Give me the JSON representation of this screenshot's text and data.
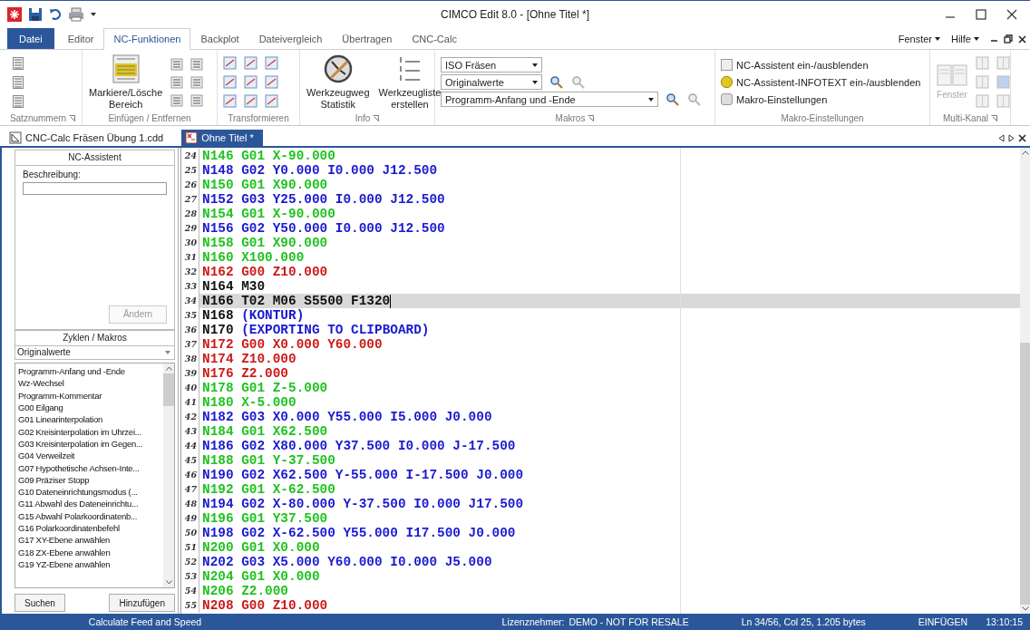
{
  "window": {
    "title": "CIMCO Edit 8.0 - [Ohne Titel *]"
  },
  "ribbon_tabs": [
    {
      "label": "Datei",
      "kind": "file",
      "selected": false
    },
    {
      "label": "Editor",
      "kind": "tab",
      "selected": false
    },
    {
      "label": "NC-Funktionen",
      "kind": "tab",
      "selected": true
    },
    {
      "label": "Backplot",
      "kind": "tab",
      "selected": false
    },
    {
      "label": "Dateivergleich",
      "kind": "tab",
      "selected": false
    },
    {
      "label": "Übertragen",
      "kind": "tab",
      "selected": false
    },
    {
      "label": "CNC-Calc",
      "kind": "tab",
      "selected": false
    }
  ],
  "menu_right": [
    "Fenster",
    "Hilfe"
  ],
  "ribbon_groups": [
    {
      "kind": "numbers",
      "label": "Satznummern",
      "launcher": true
    },
    {
      "kind": "insert",
      "label": "Einfügen / Entfernen",
      "launcher": false,
      "buttons": [
        {
          "label": "Markiere/Lösche Bereich",
          "disabled": false
        }
      ]
    },
    {
      "kind": "transform",
      "label": "Transformieren",
      "launcher": false
    },
    {
      "kind": "info",
      "label": "Info",
      "launcher": true,
      "buttons": [
        {
          "label": "Werkzeugweg Statistik",
          "disabled": false
        },
        {
          "label": "Werkzeugliste erstellen",
          "disabled": false
        }
      ]
    },
    {
      "kind": "macros",
      "label": "Makros",
      "launcher": true,
      "dropdowns": [
        "ISO Fräsen",
        "Originalwerte",
        "Programm-Anfang und -Ende"
      ]
    },
    {
      "kind": "settings",
      "label": "Makro-Einstellungen",
      "launcher": false,
      "items": [
        "NC-Assistent ein-/ausblenden",
        "NC-Assistent-INFOTEXT ein-/ausblenden",
        "Makro-Einstellungen"
      ]
    },
    {
      "kind": "multi",
      "label": "Multi-Kanal",
      "launcher": true,
      "buttons": [
        {
          "label": "Fenster",
          "disabled": true
        }
      ]
    }
  ],
  "doc_tabs": [
    {
      "label": "CNC-Calc Fräsen Übung 1.cdd",
      "selected": false
    },
    {
      "label": "Ohne Titel *",
      "selected": true
    }
  ],
  "assistant": {
    "title": "NC-Assistent",
    "description_label": "Beschreibung:",
    "change_button": "Ändern",
    "change_disabled": true,
    "macros_title": "Zyklen / Makros",
    "filter": "Originalwerte",
    "items": [
      "Programm-Anfang und -Ende",
      "Wz-Wechsel",
      "Programm-Kommentar",
      "G00 Eilgang",
      "G01 Linearinterpolation",
      "G02 Kreisinterpolation im Uhrzei...",
      "G03 Kreisinterpolation im Gegen...",
      "G04 Verweilzeit",
      "G07 Hypothetische Achsen-Inte...",
      "G09 Präziser Stopp",
      "G10 Dateneinrichtungsmodus (...",
      "G11 Abwahl des Dateneinrichtu...",
      "G15 Abwahl Polarkoordinatenb...",
      "G16 Polarkoordinatenbefehl",
      "G17 XY-Ebene anwählen",
      "G18 ZX-Ebene anwählen",
      "G19 YZ-Ebene anwählen"
    ],
    "buttons": [
      "Suchen",
      "Hinzufügen"
    ]
  },
  "code_lines": [
    {
      "number": "24",
      "current": false,
      "segments": [
        {
          "text": "N146 G01 X-90.000",
          "color": "#1fc21f"
        }
      ]
    },
    {
      "number": "25",
      "current": false,
      "segments": [
        {
          "text": "N148 G02 Y0.000 I0.000 J12.500",
          "color": "#1a1ad0"
        }
      ]
    },
    {
      "number": "26",
      "current": false,
      "segments": [
        {
          "text": "N150 G01 X90.000",
          "color": "#1fc21f"
        }
      ]
    },
    {
      "number": "27",
      "current": false,
      "segments": [
        {
          "text": "N152 G03 Y25.000 I0.000 J12.500",
          "color": "#1a1ad0"
        }
      ]
    },
    {
      "number": "28",
      "current": false,
      "segments": [
        {
          "text": "N154 G01 X-90.000",
          "color": "#1fc21f"
        }
      ]
    },
    {
      "number": "29",
      "current": false,
      "segments": [
        {
          "text": "N156 G02 Y50.000 I0.000 J12.500",
          "color": "#1a1ad0"
        }
      ]
    },
    {
      "number": "30",
      "current": false,
      "segments": [
        {
          "text": "N158 G01 X90.000",
          "color": "#1fc21f"
        }
      ]
    },
    {
      "number": "31",
      "current": false,
      "segments": [
        {
          "text": "N160 X100.000",
          "color": "#1fc21f"
        }
      ]
    },
    {
      "number": "32",
      "current": false,
      "segments": [
        {
          "text": "N162 G00 Z10.000",
          "color": "#cc1a1a"
        }
      ]
    },
    {
      "number": "33",
      "current": false,
      "segments": [
        {
          "text": "N164 M30",
          "color": "#111111"
        }
      ]
    },
    {
      "number": "34",
      "current": true,
      "segments": [
        {
          "text": "N166 T02 M06 S5500 F1320",
          "color": "#111111"
        }
      ]
    },
    {
      "number": "35",
      "current": false,
      "segments": [
        {
          "text": "N168 ",
          "color": "#111111"
        },
        {
          "text": "(KONTUR)",
          "color": "#1a1ad0"
        }
      ]
    },
    {
      "number": "36",
      "current": false,
      "segments": [
        {
          "text": "N170 ",
          "color": "#111111"
        },
        {
          "text": "(EXPORTING TO CLIPBOARD)",
          "color": "#1a1ad0"
        }
      ]
    },
    {
      "number": "37",
      "current": false,
      "segments": [
        {
          "text": "N172 G00 X0.000 Y60.000",
          "color": "#cc1a1a"
        }
      ]
    },
    {
      "number": "38",
      "current": false,
      "segments": [
        {
          "text": "N174 Z10.000",
          "color": "#cc1a1a"
        }
      ]
    },
    {
      "number": "39",
      "current": false,
      "segments": [
        {
          "text": "N176 Z2.000",
          "color": "#cc1a1a"
        }
      ]
    },
    {
      "number": "40",
      "current": false,
      "segments": [
        {
          "text": "N178 G01 Z-5.000",
          "color": "#1fc21f"
        }
      ]
    },
    {
      "number": "41",
      "current": false,
      "segments": [
        {
          "text": "N180 X-5.000",
          "color": "#1fc21f"
        }
      ]
    },
    {
      "number": "42",
      "current": false,
      "segments": [
        {
          "text": "N182 G03 X0.000 Y55.000 I5.000 J0.000",
          "color": "#1a1ad0"
        }
      ]
    },
    {
      "number": "43",
      "current": false,
      "segments": [
        {
          "text": "N184 G01 X62.500",
          "color": "#1fc21f"
        }
      ]
    },
    {
      "number": "44",
      "current": false,
      "segments": [
        {
          "text": "N186 G02 X80.000 Y37.500 I0.000 J-17.500",
          "color": "#1a1ad0"
        }
      ]
    },
    {
      "number": "45",
      "current": false,
      "segments": [
        {
          "text": "N188 G01 Y-37.500",
          "color": "#1fc21f"
        }
      ]
    },
    {
      "number": "46",
      "current": false,
      "segments": [
        {
          "text": "N190 G02 X62.500 Y-55.000 I-17.500 J0.000",
          "color": "#1a1ad0"
        }
      ]
    },
    {
      "number": "47",
      "current": false,
      "segments": [
        {
          "text": "N192 G01 X-62.500",
          "color": "#1fc21f"
        }
      ]
    },
    {
      "number": "48",
      "current": false,
      "segments": [
        {
          "text": "N194 G02 X-80.000 Y-37.500 I0.000 J17.500",
          "color": "#1a1ad0"
        }
      ]
    },
    {
      "number": "49",
      "current": false,
      "segments": [
        {
          "text": "N196 G01 Y37.500",
          "color": "#1fc21f"
        }
      ]
    },
    {
      "number": "50",
      "current": false,
      "segments": [
        {
          "text": "N198 G02 X-62.500 Y55.000 I17.500 J0.000",
          "color": "#1a1ad0"
        }
      ]
    },
    {
      "number": "51",
      "current": false,
      "segments": [
        {
          "text": "N200 G01 X0.000",
          "color": "#1fc21f"
        }
      ]
    },
    {
      "number": "52",
      "current": false,
      "segments": [
        {
          "text": "N202 G03 X5.000 Y60.000 I0.000 J5.000",
          "color": "#1a1ad0"
        }
      ]
    },
    {
      "number": "53",
      "current": false,
      "segments": [
        {
          "text": "N204 G01 X0.000",
          "color": "#1fc21f"
        }
      ]
    },
    {
      "number": "54",
      "current": false,
      "segments": [
        {
          "text": "N206 Z2.000",
          "color": "#1fc21f"
        }
      ]
    },
    {
      "number": "55",
      "current": false,
      "segments": [
        {
          "text": "N208 G00 Z10.000",
          "color": "#cc1a1a"
        }
      ]
    }
  ],
  "status_bar": {
    "hint": "Calculate Feed and Speed",
    "license_label": "Lizenznehmer:",
    "license": "DEMO - NOT FOR RESALE",
    "position": "Ln 34/56, Col 25, 1.205 bytes",
    "mode": "EINFÜGEN",
    "time": "13:10:15"
  }
}
